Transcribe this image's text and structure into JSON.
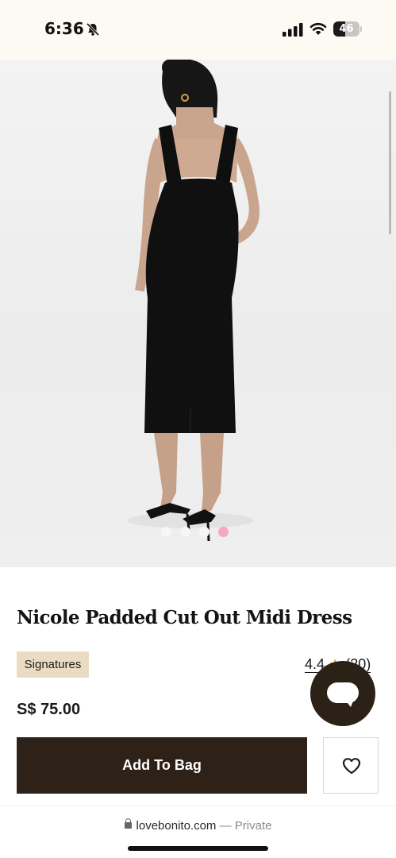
{
  "status_bar": {
    "time": "6:36",
    "battery_level": "46",
    "battery_fraction": 0.46,
    "icons": [
      "bell-slash-icon",
      "cellular-signal-icon",
      "wifi-icon",
      "battery-icon"
    ]
  },
  "gallery": {
    "image_count": 4,
    "active_index": 3,
    "active_dot_color": "#f4a7c6"
  },
  "product": {
    "title": "Nicole Padded Cut Out Midi Dress",
    "badge": "Signatures",
    "rating_value": "4.4",
    "rating_star": "★",
    "rating_count": "(20)",
    "price": "S$ 75.00"
  },
  "actions": {
    "add_to_bag": "Add To Bag",
    "add_to_bag_color": "#2e2118",
    "wishlist_icon": "heart-icon",
    "chat_icon": "chat-bubble-icon"
  },
  "browser": {
    "domain": "lovebonito.com",
    "separator": "—",
    "mode": "Private"
  }
}
